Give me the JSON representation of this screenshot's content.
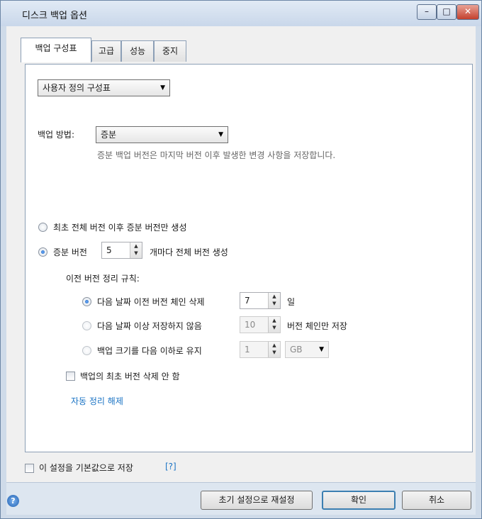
{
  "window": {
    "title": "디스크 백업 옵션",
    "min": "–",
    "max": "□",
    "close": "✕"
  },
  "tabs": [
    "백업 구성표",
    "고급",
    "성능",
    "중지"
  ],
  "scheme_combo": "사용자 정의 구성표",
  "backup_method": {
    "label": "백업 방법:",
    "value": "증분",
    "description": "증분 백업 버전은 마지막 버전 이후 발생한 변경 사항을 저장합니다."
  },
  "options": {
    "first_full": "최초 전체 버전 이후 증분 버전만 생성",
    "incremental_prefix": "증분 버전",
    "incremental_count": "5",
    "incremental_suffix": "개마다 전체 버전 생성"
  },
  "cleanup": {
    "header": "이전 버전 정리 규칙:",
    "delete_older": {
      "label": "다음 날짜 이전 버전 체인 삭제",
      "value": "7",
      "unit": "일"
    },
    "keep_count": {
      "label": "다음 날짜 이상 저장하지 않음",
      "value": "10",
      "unit": "버전 체인만 저장"
    },
    "size_limit": {
      "label": "백업 크기를 다음 이하로 유지",
      "value": "1",
      "unit": "GB"
    }
  },
  "no_delete_first": "백업의 최초 버전 삭제 안 함",
  "disable_cleanup_link": "자동 정리 해제",
  "save_default": {
    "label": "이 설정을 기본값으로 저장",
    "help_link": "[?]"
  },
  "buttons": {
    "reset": "초기 설정으로 재설정",
    "ok": "확인",
    "cancel": "취소"
  },
  "icons": {
    "help": "?"
  },
  "colors": {
    "accent": "#1a73c4",
    "title_bar": "#cfdbe9",
    "close": "#c4412e"
  }
}
